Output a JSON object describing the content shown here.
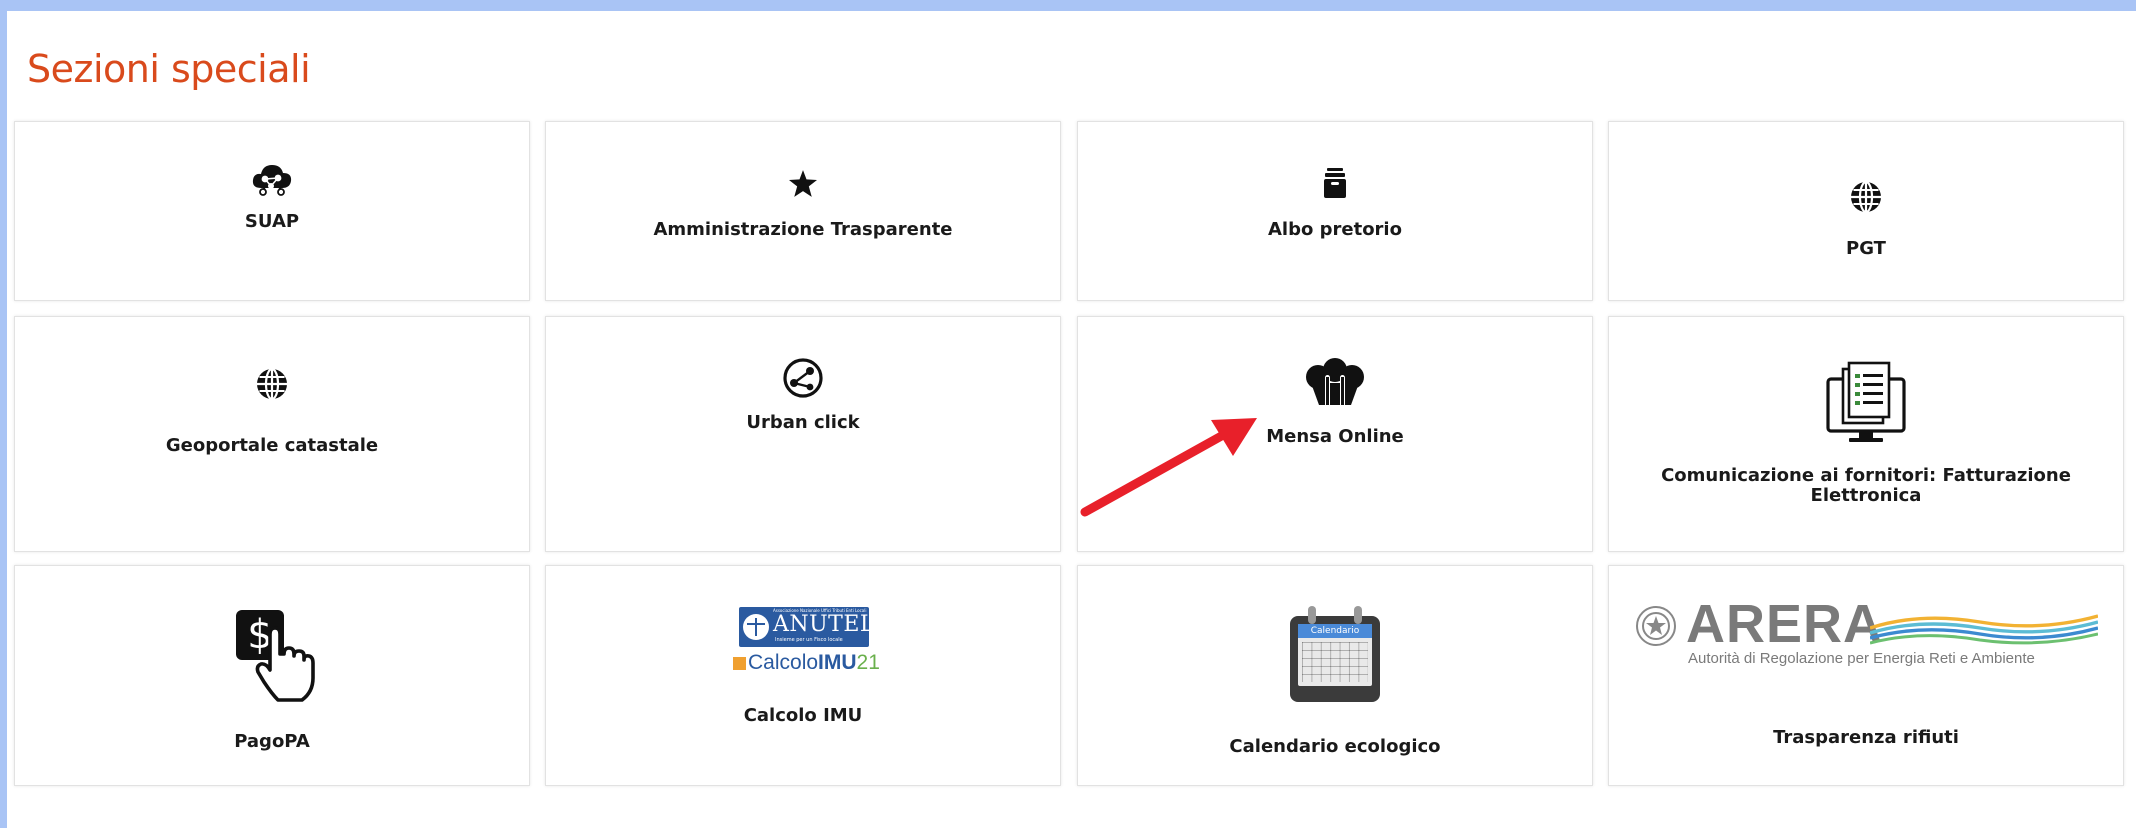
{
  "section": {
    "title": "Sezioni speciali"
  },
  "cards": [
    {
      "label": "SUAP",
      "icon": "cloud-network-icon"
    },
    {
      "label": "Amministrazione Trasparente",
      "icon": "star-icon"
    },
    {
      "label": "Albo pretorio",
      "icon": "archive-box-icon"
    },
    {
      "label": "PGT",
      "icon": "globe-icon"
    },
    {
      "label": "Geoportale catastale",
      "icon": "globe-icon"
    },
    {
      "label": "Urban click",
      "icon": "network-circle-icon"
    },
    {
      "label": "Mensa Online",
      "icon": "chef-hat-cutlery-icon"
    },
    {
      "label": "Comunicazione ai fornitori: Fatturazione Elettronica",
      "icon": "monitor-invoice-icon"
    },
    {
      "label": "PagoPA",
      "icon": "pagopa-dollar-click-icon"
    },
    {
      "label": "Calcolo IMU",
      "icon": "anutel-calcolo-imu-logo"
    },
    {
      "label": "Calendario ecologico",
      "icon": "calendar-icon"
    },
    {
      "label": "Trasparenza rifiuti",
      "icon": "arera-logo"
    }
  ],
  "logos": {
    "anutel": {
      "name": "ANUTEL",
      "tagline": "Associazione Nazionale Uffici Tributi Enti Locali",
      "sub": "Insieme per un Fisco locale",
      "calcolo": "Calcolo",
      "imu": "IMU",
      "year": "21"
    },
    "calendar": {
      "header": "Calendario"
    },
    "arera": {
      "name": "ARERA",
      "tagline": "Autorità di Regolazione per Energia Reti e Ambiente"
    }
  },
  "colors": {
    "title": "#d94a1c",
    "arrow": "#e8202a",
    "background_band": "#a9c4f5"
  }
}
